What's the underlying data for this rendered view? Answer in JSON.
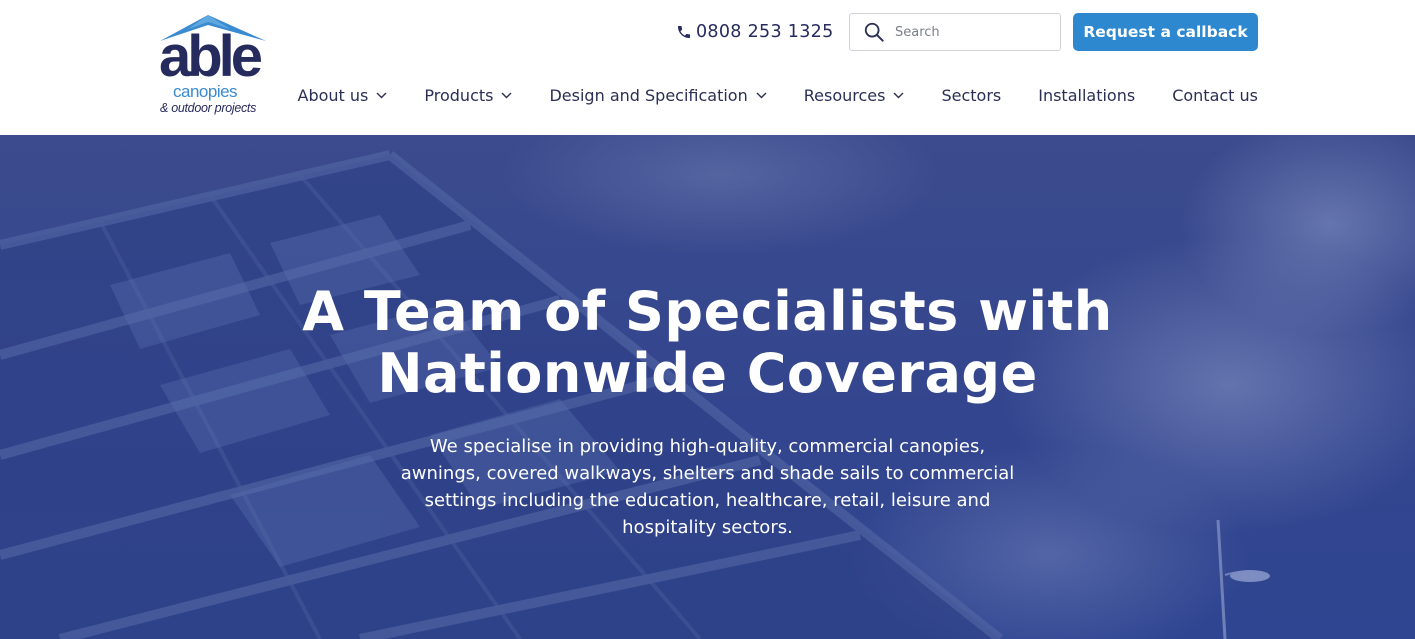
{
  "brand": {
    "logo_main": "able",
    "logo_sub": "canopies",
    "logo_tagline": "& outdoor projects",
    "primary_color": "#262b5e",
    "accent_color": "#2e88cf"
  },
  "header": {
    "phone": {
      "icon": "phone-icon",
      "number": "0808 253 1325"
    },
    "search": {
      "icon": "search-icon",
      "placeholder": "Search",
      "value": ""
    },
    "callback_label": "Request a callback"
  },
  "nav": {
    "items": [
      {
        "label": "About us",
        "has_dropdown": true
      },
      {
        "label": "Products",
        "has_dropdown": true
      },
      {
        "label": "Design and Specification",
        "has_dropdown": true
      },
      {
        "label": "Resources",
        "has_dropdown": true
      },
      {
        "label": "Sectors",
        "has_dropdown": false
      },
      {
        "label": "Installations",
        "has_dropdown": false
      },
      {
        "label": "Contact us",
        "has_dropdown": false
      }
    ]
  },
  "hero": {
    "title_line1": "A Team of Specialists with",
    "title_line2": "Nationwide Coverage",
    "subtitle": "We specialise in providing high-quality, commercial canopies, awnings, covered walkways, shelters and shade sails to commercial settings including the education, healthcare, retail, leisure and hospitality sectors.",
    "overlay_color": "#33458e"
  }
}
